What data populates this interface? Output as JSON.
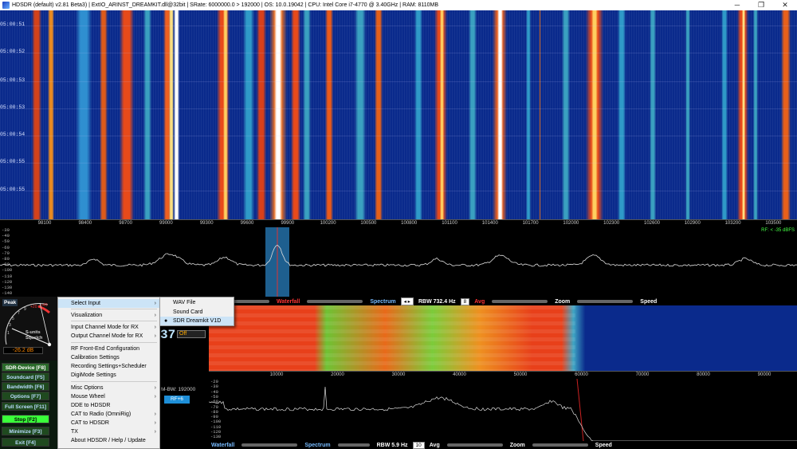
{
  "window": {
    "title": "HDSDR  (default)  v2.81 Beta3)  |  ExtIO_ARINST_DREAMKIT.dll@32bit  |  SRate: 6000000.0 > 192000  |  OS: 10.0.19042  |  CPU: Intel Core i7-4770 @ 3.40GHz  |  RAM: 8110MB",
    "minimize": "─",
    "maximize": "❐",
    "close": "✕"
  },
  "waterfall": {
    "times": [
      "05:00:51",
      "05:00:52",
      "05:00:53",
      "05:00:53",
      "05:00:54",
      "05:00:55",
      "05:00:55"
    ],
    "freq_labels": [
      "98100",
      "98400",
      "98700",
      "99000",
      "99300",
      "99600",
      "99900",
      "100200",
      "100500",
      "100800",
      "101100",
      "101400",
      "101700",
      "102000",
      "102300",
      "102600",
      "102900",
      "103200",
      "103500"
    ]
  },
  "spectrum": {
    "y_labels": [
      "-30",
      "-40",
      "-50",
      "-60",
      "-70",
      "-80",
      "-90",
      "-100",
      "-110",
      "-120",
      "-130",
      "-140"
    ],
    "rf_readout": "RF: < -35 dBFS"
  },
  "top_bar": {
    "waterfall_label": "Waterfall",
    "spectrum_label": "Spectrum",
    "rbw_label": "RBW  732.4 Hz",
    "avg_value": "8",
    "avg_label": "Avg",
    "zoom_label": "Zoom",
    "speed_label": "Speed"
  },
  "bottom_bar": {
    "waterfall_label": "Waterfall",
    "spectrum_label": "Spectrum",
    "rbw_label": "RBW  5.9 Hz",
    "avg_value": "10",
    "avg_label": "Avg",
    "zoom_label": "Zoom",
    "speed_label": "Speed"
  },
  "smeter": {
    "peak": "Peak",
    "units": "S-units",
    "squelch": "Squelch",
    "db_value": "-26.2 dB",
    "scale": [
      "1",
      "3",
      "5",
      "7",
      "9",
      "+20",
      "+40"
    ]
  },
  "left_buttons": [
    {
      "label": "SDR-Device  [F8]",
      "style": "green"
    },
    {
      "label": "Soundcard  [F5]",
      "style": "dark"
    },
    {
      "label": "Bandwidth  [F6]",
      "style": "dark"
    },
    {
      "label": "Options  [F7]",
      "style": "dark"
    },
    {
      "label": "Full Screen  [F11]",
      "style": "dark"
    },
    {
      "label": "Stop  [F2]",
      "style": "bright"
    },
    {
      "label": "Minimize  [F3]",
      "style": "dark"
    },
    {
      "label": "Exit  [F4]",
      "style": "dark"
    }
  ],
  "mid_panel": {
    "big_number": "37",
    "off_select": "Off",
    "mbw": "M-BW: 192000",
    "rf_button": "RF+6"
  },
  "sub_axis_labels": [
    "10000",
    "20000",
    "30000",
    "40000",
    "50000",
    "60000",
    "70000",
    "80000",
    "90000"
  ],
  "sub_spec_y": [
    "-20",
    "-30",
    "-40",
    "-50",
    "-60",
    "-70",
    "-80",
    "-90",
    "-100",
    "-110",
    "-120",
    "-130"
  ],
  "menu": {
    "items": [
      {
        "label": "Select Input",
        "arrow": true,
        "hl": true
      },
      {
        "label": "Visualization",
        "arrow": true
      },
      {
        "label": "Input Channel Mode for RX",
        "arrow": true
      },
      {
        "label": "Output Channel Mode for RX",
        "arrow": true
      },
      {
        "label": "RF Front-End Configuration",
        "arrow": false
      },
      {
        "label": "Calibration Settings",
        "arrow": false
      },
      {
        "label": "Recording Settings+Scheduler",
        "arrow": false
      },
      {
        "label": "DigiMode Settings",
        "arrow": false
      },
      {
        "label": "Misc Options",
        "arrow": true
      },
      {
        "label": "Mouse Wheel",
        "arrow": true
      },
      {
        "label": "DDE to HDSDR",
        "arrow": false
      },
      {
        "label": "CAT to Radio (OmniRig)",
        "arrow": true
      },
      {
        "label": "CAT to HDSDR",
        "arrow": true
      },
      {
        "label": "TX",
        "arrow": true
      },
      {
        "label": "About HDSDR / Help / Update",
        "arrow": false
      }
    ],
    "arrow_glyph": "›"
  },
  "submenu": {
    "items": [
      {
        "label": "WAV File",
        "checked": false
      },
      {
        "label": "Sound Card",
        "checked": false
      },
      {
        "label": "SDR Dreamkit V1D",
        "checked": true
      }
    ],
    "bullet": "●"
  }
}
